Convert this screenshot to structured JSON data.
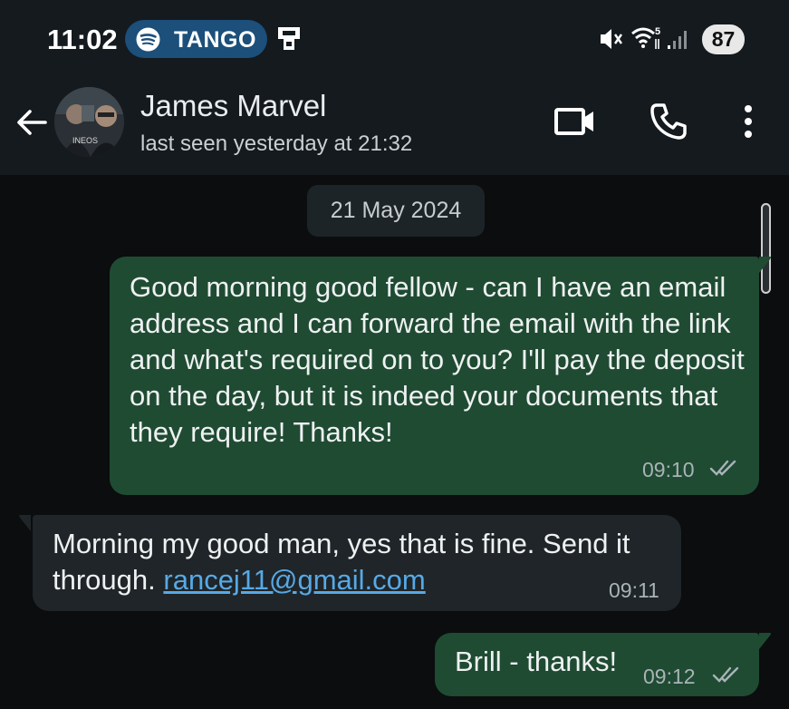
{
  "status_bar": {
    "time": "11:02",
    "spotify_label": "TANGO",
    "battery": "87",
    "icons": [
      "spotify-icon",
      "cast-icon",
      "mute-icon",
      "wifi-5-icon",
      "signal-icon"
    ]
  },
  "header": {
    "name": "James Marvel",
    "status": "last seen yesterday at 21:32",
    "icons": [
      "back-arrow-icon",
      "video-call-icon",
      "voice-call-icon",
      "more-options-icon"
    ]
  },
  "chat": {
    "date_chip": "21 May 2024",
    "messages": [
      {
        "direction": "outgoing",
        "text": "Good morning good fellow - can I have an email address and I can forward the email with the link and what's required on to you? I'll pay the deposit on the day, but it is indeed your documents that they require! Thanks!",
        "time": "09:10",
        "read": true
      },
      {
        "direction": "incoming",
        "text": "Morning my good man, yes that is fine. Send it through.",
        "link": "rancej11@gmail.com",
        "time": "09:11"
      },
      {
        "direction": "outgoing",
        "text": "Brill - thanks!",
        "time": "09:12",
        "read": true
      }
    ]
  },
  "colors": {
    "background": "#0b0d0e",
    "bar": "#141a1e",
    "outgoing_bubble": "#1f4b32",
    "incoming_bubble": "#1f2528",
    "link": "#57a9e6",
    "spotify_pill": "#1c4f7a"
  }
}
